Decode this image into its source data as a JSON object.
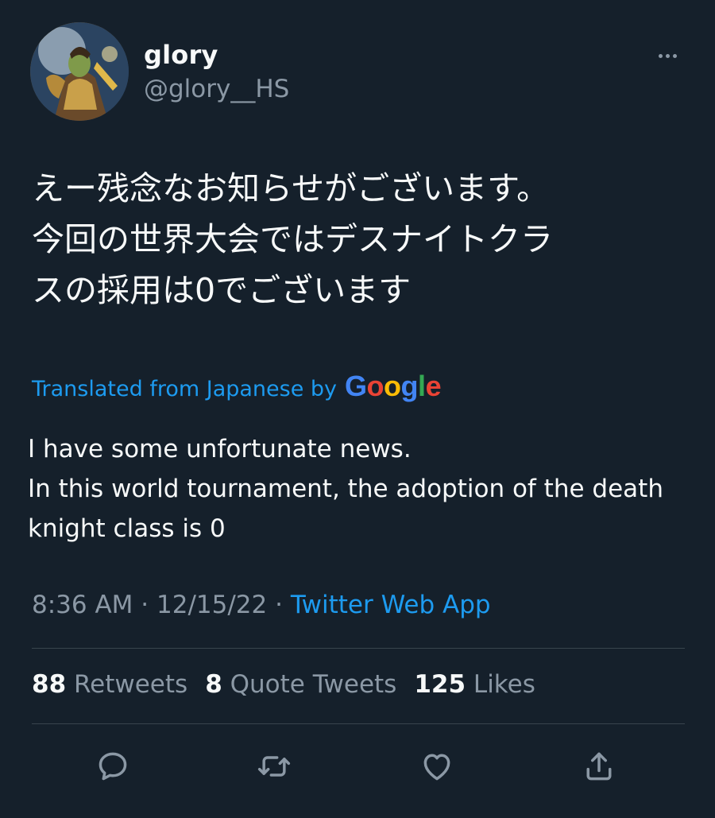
{
  "author": {
    "display_name": "glory",
    "handle": "@glory__HS",
    "avatar_icon": "avatar"
  },
  "tweet": {
    "jp_lines": [
      "えー残念なお知らせがございます。",
      "今回の世界大会ではデスナイトクラ",
      "スの採用は0でございます"
    ],
    "translated_label": "Translated from Japanese by",
    "translation_provider": "Google",
    "en_lines": [
      "I have some unfortunate news.",
      "In this world tournament, the adoption of the death",
      "knight class is 0"
    ]
  },
  "meta": {
    "time": "8:36 AM",
    "separator": "·",
    "date": "12/15/22",
    "source": "Twitter Web App"
  },
  "stats": {
    "retweets_count": "88",
    "retweets_label": "Retweets",
    "quotes_count": "8",
    "quotes_label": "Quote Tweets",
    "likes_count": "125",
    "likes_label": "Likes"
  },
  "actions": [
    "reply-icon",
    "retweet-icon",
    "like-icon",
    "share-icon"
  ],
  "colors": {
    "background": "#15202b",
    "text": "#f7f9f9",
    "secondary": "#8b98a5",
    "accent": "#1d9bf0",
    "divider": "#38444d"
  }
}
